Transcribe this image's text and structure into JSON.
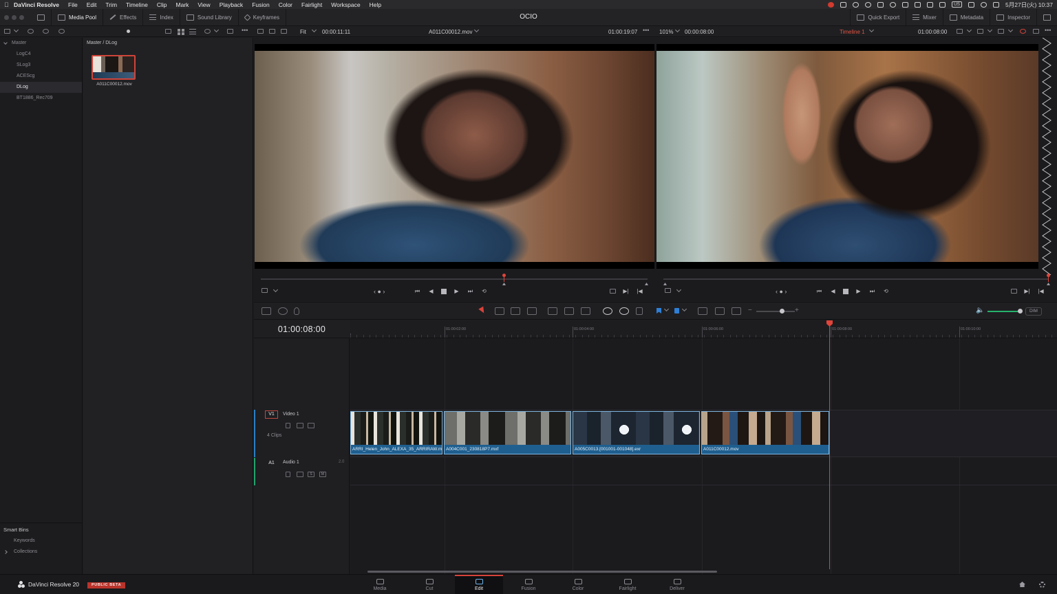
{
  "menubar": {
    "items": [
      "File",
      "Edit",
      "Trim",
      "Timeline",
      "Clip",
      "Mark",
      "View",
      "Playback",
      "Fusion",
      "Color",
      "Fairlight",
      "Workspace",
      "Help"
    ],
    "app_name": "DaVinci Resolve",
    "keyboard": "US",
    "datetime": "5月27日(火) 10:37"
  },
  "toolbar": {
    "title": "OCIO",
    "media_pool": "Media Pool",
    "effects": "Effects",
    "index": "Index",
    "sound_library": "Sound Library",
    "keyframes": "Keyframes",
    "quick_export": "Quick Export",
    "mixer": "Mixer",
    "metadata": "Metadata",
    "inspector": "Inspector"
  },
  "viewer_bar": {
    "fit": "Fit",
    "source_duration": "00:00:11:11",
    "source_clip": "A011C00012.mov",
    "source_timecode": "01:00:19:07",
    "zoom": "101%",
    "timeline_duration": "00:00:08:00",
    "timeline_name": "Timeline 1",
    "timeline_timecode": "01:00:08:00"
  },
  "bins": {
    "root": "Master",
    "items": [
      "LogC4",
      "SLog3",
      "ACEScg",
      "DLog",
      "BT1886_Rec709"
    ],
    "selected": "DLog"
  },
  "smart_bins": {
    "title": "Smart Bins",
    "items": [
      "Keywords",
      "Collections"
    ]
  },
  "media_pool": {
    "path": "Master / DLog",
    "clip_name": "A011C00012.mov"
  },
  "timeline": {
    "timecode": "01:00:08:00",
    "ruler_labels": [
      "01:00:02:00",
      "01:00:04:00",
      "01:00:06:00",
      "01:00:08:00",
      "01:00:10:00"
    ],
    "video_track": {
      "id": "V1",
      "name": "Video 1",
      "clip_count": "4 Clips"
    },
    "audio_track": {
      "id": "A1",
      "name": "Audio 1",
      "channels": "2.0",
      "solo": "S",
      "mute": "M"
    },
    "clips": [
      "ARRI_Helen_John_ALEXA_35_ARRIRAW.mxf",
      "A004C001_230818P7.mxf",
      "A005C0013.[001001-001048].exr",
      "A011C00012.mov"
    ],
    "dim": "DIM"
  },
  "bottombar": {
    "brand": "DaVinci Resolve 20",
    "beta": "PUBLIC BETA",
    "pages": [
      "Media",
      "Cut",
      "Edit",
      "Fusion",
      "Color",
      "Fairlight",
      "Deliver"
    ],
    "active_page": "Edit"
  },
  "colors": {
    "accent_red": "#e0443a",
    "clip_blue": "#1f5f8f",
    "volume_green": "#26b36a",
    "flag_blue": "#2f7fd6"
  }
}
